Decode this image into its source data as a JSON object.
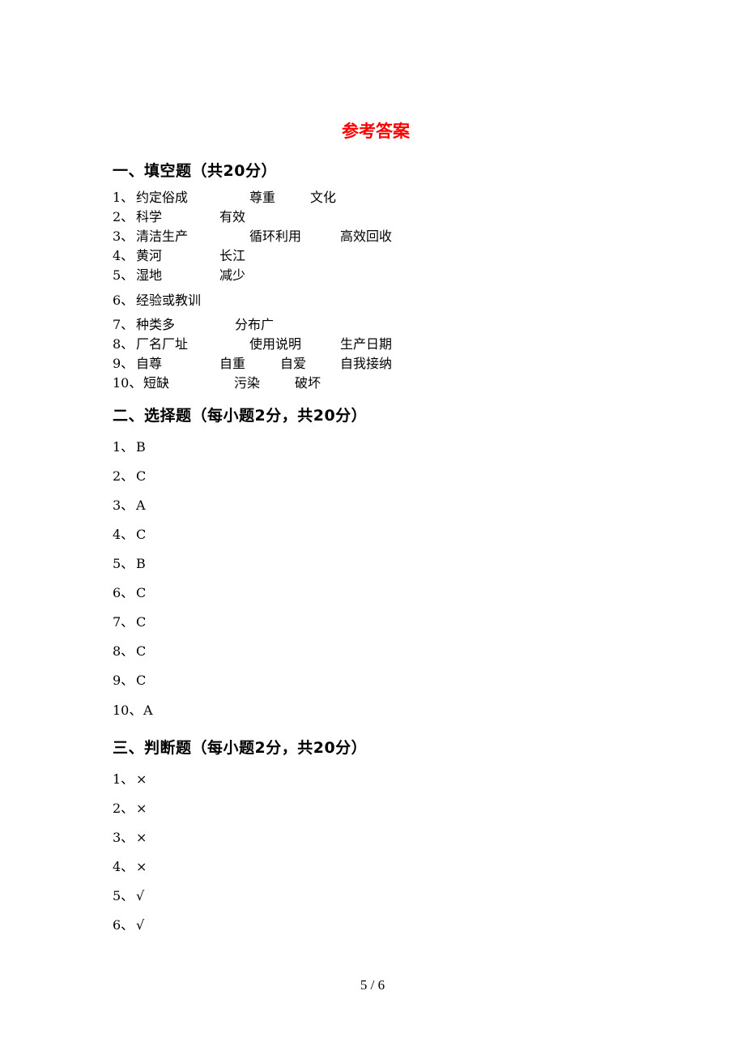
{
  "title": "参考答案",
  "sections": [
    {
      "heading": "一、填空题（共20分）",
      "items": [
        {
          "num": "1、",
          "answers": [
            "约定俗成",
            "尊重",
            "文化"
          ]
        },
        {
          "num": "2、",
          "answers": [
            "科学",
            "有效"
          ]
        },
        {
          "num": "3、",
          "answers": [
            "清洁生产",
            "循环利用",
            "高效回收"
          ]
        },
        {
          "num": "4、",
          "answers": [
            "黄河",
            "长江"
          ]
        },
        {
          "num": "5、",
          "answers": [
            "湿地",
            "减少"
          ]
        },
        {
          "num": "6、",
          "answers": [
            "经验或教训"
          ]
        },
        {
          "num": "7、",
          "answers": [
            "种类多",
            "分布广"
          ]
        },
        {
          "num": "8、",
          "answers": [
            "厂名厂址",
            "使用说明",
            "生产日期"
          ]
        },
        {
          "num": "9、",
          "answers": [
            "自尊",
            "自重",
            "自爱",
            "自我接纳"
          ]
        },
        {
          "num": "10、",
          "answers": [
            "短缺",
            "污染",
            "破坏"
          ]
        }
      ]
    },
    {
      "heading": "二、选择题（每小题2分，共20分）",
      "items": [
        {
          "num": "1、",
          "answers": [
            "B"
          ]
        },
        {
          "num": "2、",
          "answers": [
            "C"
          ]
        },
        {
          "num": "3、",
          "answers": [
            "A"
          ]
        },
        {
          "num": "4、",
          "answers": [
            "C"
          ]
        },
        {
          "num": "5、",
          "answers": [
            "B"
          ]
        },
        {
          "num": "6、",
          "answers": [
            "C"
          ]
        },
        {
          "num": "7、",
          "answers": [
            "C"
          ]
        },
        {
          "num": "8、",
          "answers": [
            "C"
          ]
        },
        {
          "num": "9、",
          "answers": [
            "C"
          ]
        },
        {
          "num": "10、",
          "answers": [
            "A"
          ]
        }
      ]
    },
    {
      "heading": "三、判断题（每小题2分，共20分）",
      "items": [
        {
          "num": "1、",
          "answers": [
            "×"
          ]
        },
        {
          "num": "2、",
          "answers": [
            "×"
          ]
        },
        {
          "num": "3、",
          "answers": [
            "×"
          ]
        },
        {
          "num": "4、",
          "answers": [
            "×"
          ]
        },
        {
          "num": "5、",
          "answers": [
            "√"
          ]
        },
        {
          "num": "6、",
          "answers": [
            "√"
          ]
        }
      ]
    }
  ],
  "footer": {
    "page_indicator": "5 / 6"
  }
}
